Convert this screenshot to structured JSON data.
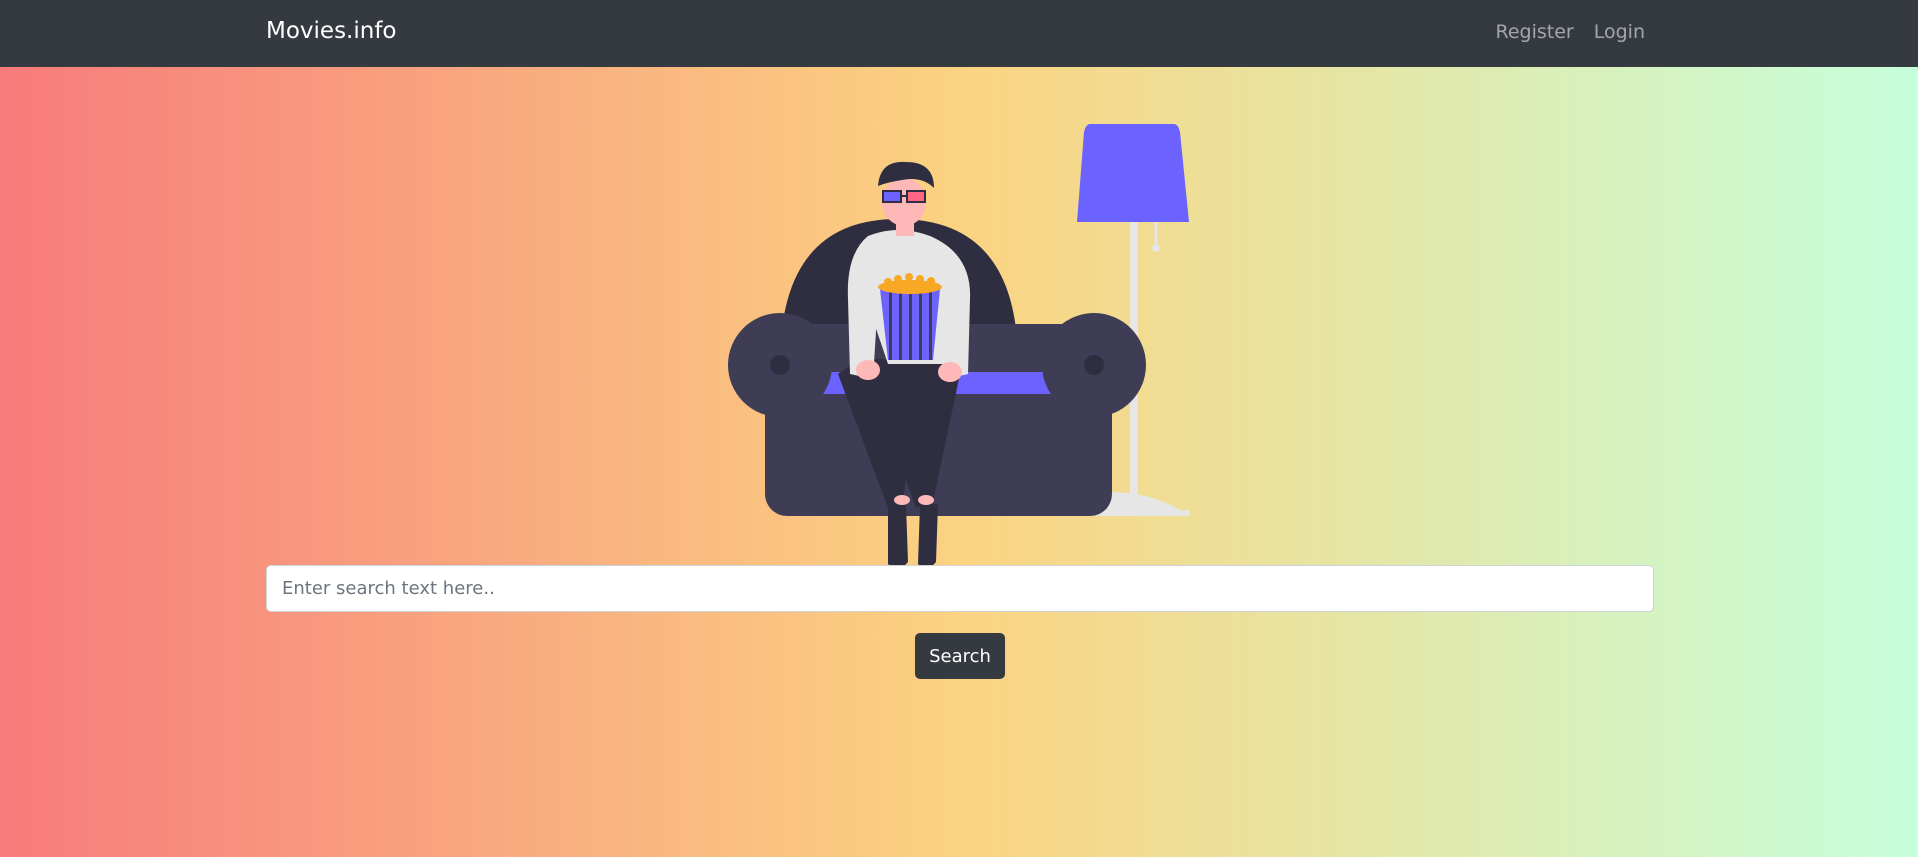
{
  "navbar": {
    "brand": "Movies.info",
    "links": [
      {
        "label": "Register"
      },
      {
        "label": "Login"
      }
    ]
  },
  "hero": {
    "illustration_icon": "person-on-sofa-with-popcorn-icon"
  },
  "search": {
    "value": "",
    "placeholder": "Enter search text here..",
    "button_label": "Search"
  },
  "colors": {
    "navbar_bg": "#343a40",
    "gradient_start": "#f87b7b",
    "gradient_mid": "#fbd381",
    "gradient_end": "#c6ffdb",
    "accent_purple": "#6c63ff",
    "sofa_dark": "#3f3d56",
    "button_bg": "#343a40"
  }
}
